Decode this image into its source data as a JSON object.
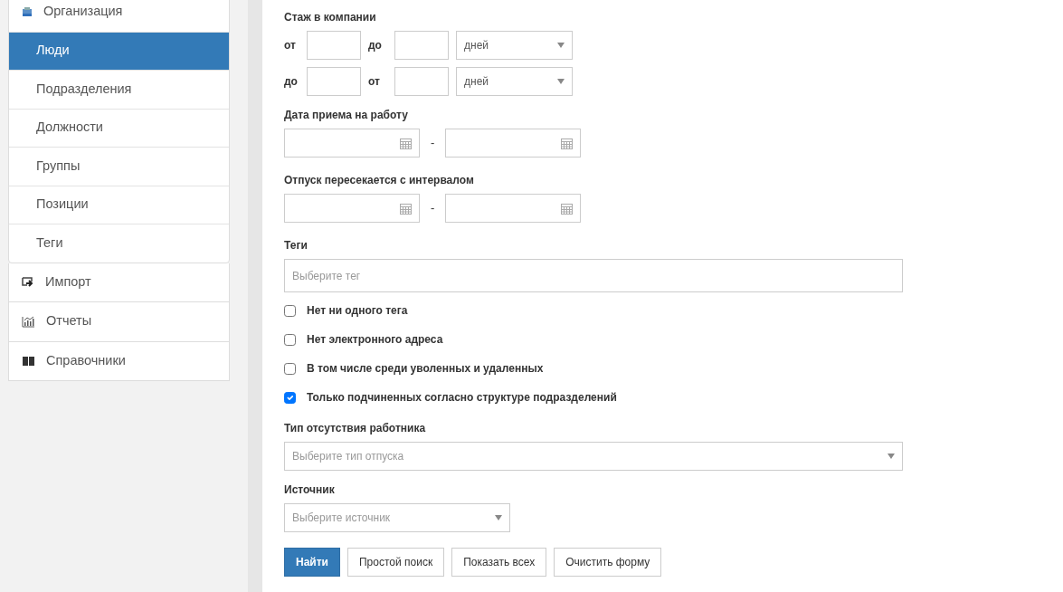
{
  "sidebar": {
    "items": [
      {
        "label": "Организация",
        "selected": false,
        "children": [
          {
            "label": "Люди",
            "selected": true
          },
          {
            "label": "Подразделения",
            "selected": false
          },
          {
            "label": "Должности",
            "selected": false
          },
          {
            "label": "Группы",
            "selected": false
          },
          {
            "label": "Позиции",
            "selected": false
          },
          {
            "label": "Теги",
            "selected": false
          }
        ]
      },
      {
        "label": "Импорт",
        "selected": false
      },
      {
        "label": "Отчеты",
        "selected": false
      },
      {
        "label": "Справочники",
        "selected": false
      }
    ]
  },
  "form": {
    "tenure": {
      "label": "Стаж в компании",
      "rows": [
        {
          "first_label": "от",
          "second_label": "до",
          "unit": "дней"
        },
        {
          "first_label": "до",
          "second_label": "от",
          "unit": "дней"
        }
      ]
    },
    "date_ranges": [
      {
        "label": "Дата приема на работу",
        "separator": "-"
      },
      {
        "label": "Отпуск пересекается с интервалом",
        "separator": "-"
      }
    ],
    "tags": {
      "label": "Теги",
      "placeholder": "Выберите тег"
    },
    "checkboxes": [
      {
        "label": "Нет ни одного тега",
        "checked": false
      },
      {
        "label": "Нет электронного адреса",
        "checked": false
      },
      {
        "label": "В том числе среди уволенных и удаленных",
        "checked": false
      },
      {
        "label": "Только подчиненных согласно структуре подразделений",
        "checked": true
      }
    ],
    "absence_type": {
      "label": "Тип отсутствия работника",
      "placeholder": "Выберите тип отпуска"
    },
    "source": {
      "label": "Источник",
      "placeholder": "Выберите источник"
    },
    "buttons": [
      {
        "label": "Найти",
        "kind": "primary"
      },
      {
        "label": "Простой поиск",
        "kind": "default"
      },
      {
        "label": "Показать всех",
        "kind": "default"
      },
      {
        "label": "Очистить форму",
        "kind": "default"
      }
    ]
  }
}
